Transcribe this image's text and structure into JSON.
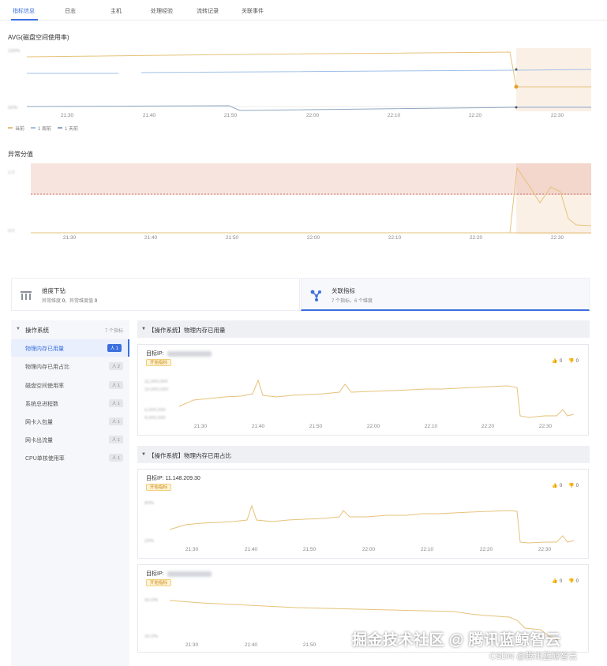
{
  "tabs": [
    {
      "label": "指标信息",
      "active": true
    },
    {
      "label": "日志",
      "active": false
    },
    {
      "label": "主机",
      "active": false
    },
    {
      "label": "处理经验",
      "active": false
    },
    {
      "label": "流转记录",
      "active": false
    },
    {
      "label": "关联事件",
      "active": false
    }
  ],
  "colors": {
    "accent": "#3b6fe0",
    "current": "#e6c27a",
    "week_ago": "#9fc0e8",
    "day_ago": "#8fa6c2",
    "anomaly_band": "#f6dcd6",
    "threshold": "#b85a4a"
  },
  "time_ticks": [
    "21:30",
    "21:40",
    "21:50",
    "22:00",
    "22:10",
    "22:20",
    "22:30"
  ],
  "chart1": {
    "title": "AVG(磁盘空间使用率)",
    "legend": [
      {
        "label": "当前",
        "color": "#e6c27a"
      },
      {
        "label": "1 周前",
        "color": "#9fc0e8"
      },
      {
        "label": "1 天前",
        "color": "#8fa6c2"
      }
    ]
  },
  "chart2": {
    "title": "异常分值"
  },
  "dim_card": {
    "title": "维度下钻",
    "sub_prefix": "异常维度",
    "anomaly_dims": "0",
    "sep": "，",
    "sub_mid": "异常维度值",
    "anomaly_values": "0"
  },
  "rel_card": {
    "title": "关联指标",
    "sub": "7 个指标，6 个维度"
  },
  "sidebar": {
    "header": {
      "label": "操作系统",
      "count": "7 个指标"
    },
    "items": [
      {
        "label": "物理内存已用量",
        "badge": "人 1",
        "active": true
      },
      {
        "label": "物理内存已用占比",
        "badge": "人 2",
        "active": false
      },
      {
        "label": "磁盘空间使用率",
        "badge": "人 1",
        "active": false
      },
      {
        "label": "系统总进程数",
        "badge": "人 1",
        "active": false
      },
      {
        "label": "网卡入包量",
        "badge": "人 1",
        "active": false
      },
      {
        "label": "网卡出流量",
        "badge": "人 1",
        "active": false
      },
      {
        "label": "CPU单核使用率",
        "badge": "人 1",
        "active": false
      }
    ]
  },
  "groups": [
    {
      "label": "【操作系统】物理内存已用量"
    },
    {
      "label": "【操作系统】物理内存已用占比"
    }
  ],
  "cards": [
    {
      "target_label": "目标IP:",
      "target_ip": "",
      "tag": "开始指标",
      "likes": "0",
      "dislikes": "0"
    },
    {
      "target_label": "目标IP:",
      "target_ip": "11.148.209.30",
      "tag": "开始指标",
      "likes": "0",
      "dislikes": "0"
    },
    {
      "target_label": "目标IP:",
      "target_ip": "",
      "tag": "开始指标",
      "likes": "0",
      "dislikes": "0"
    }
  ],
  "watermark": {
    "main": "掘金技术社区 @ 腾讯蓝鲸智云",
    "sub": "CSDN @腾讯蓝鲸智云"
  }
}
